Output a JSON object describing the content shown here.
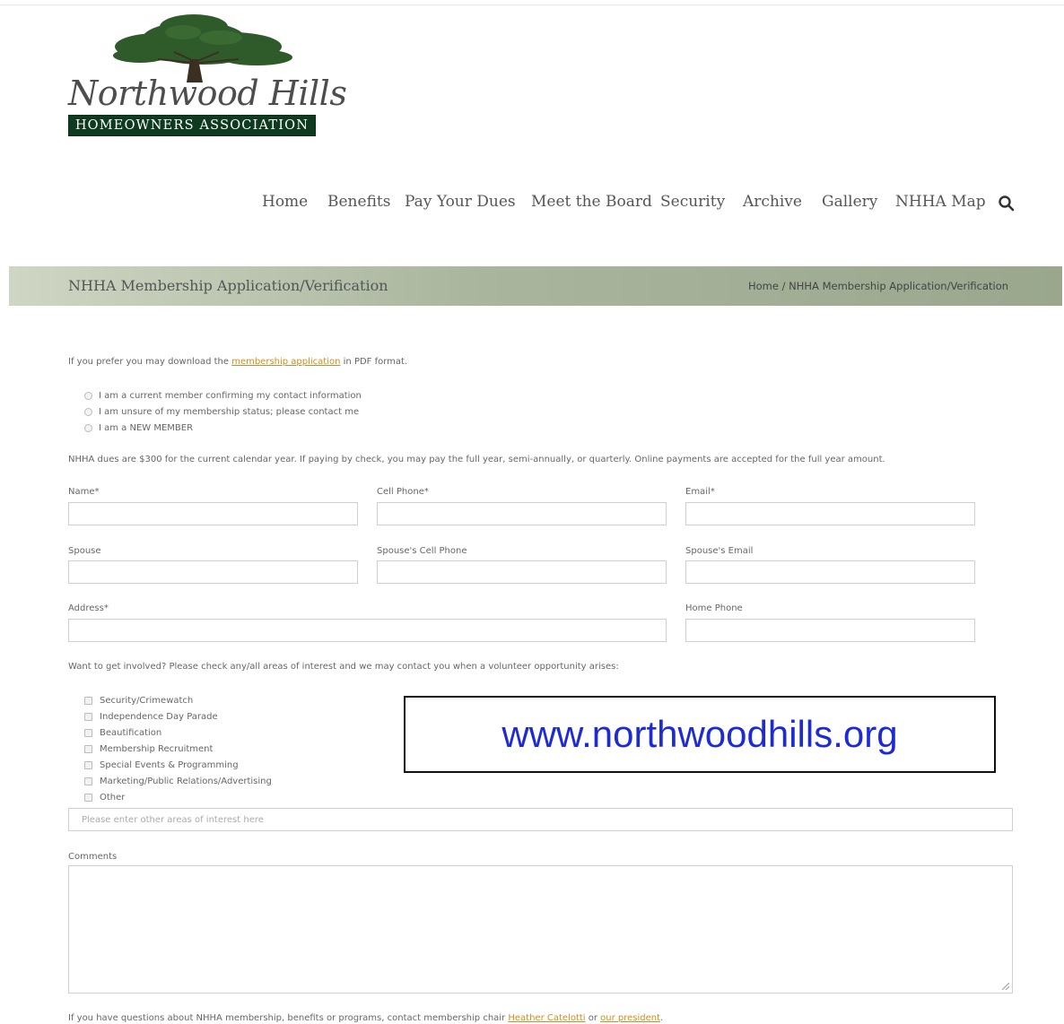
{
  "logo": {
    "script_text": "Northwood Hills",
    "band_text": "HOMEOWNERS ASSOCIATION"
  },
  "nav": {
    "items": [
      {
        "label": "Home"
      },
      {
        "label": "Benefits"
      },
      {
        "label": "Pay Your Dues"
      },
      {
        "label": "Meet the Board"
      },
      {
        "label": "Security"
      },
      {
        "label": "Archive"
      },
      {
        "label": "Gallery"
      },
      {
        "label": "NHHA Map"
      }
    ],
    "search_icon": "search-icon"
  },
  "title_bar": {
    "title": "NHHA Membership Application/Verification",
    "breadcrumb_home": "Home",
    "breadcrumb_sep": " / ",
    "breadcrumb_current": "NHHA Membership Application/Verification"
  },
  "intro": {
    "before": "If you prefer you may download the ",
    "link": "membership application",
    "after": " in PDF format."
  },
  "status_options": [
    {
      "label": "I am a current member confirming my contact information"
    },
    {
      "label": "I am unsure of my membership status; please contact me"
    },
    {
      "label": "I am a NEW MEMBER"
    }
  ],
  "dues_text": "NHHA dues are $300 for the current calendar year. If paying by check, you may pay the full year, semi-annually, or quarterly. Online payments are accepted for the full year amount.",
  "fields": {
    "name": "Name*",
    "cell_phone": "Cell Phone*",
    "email": "Email*",
    "spouse": "Spouse",
    "spouse_cell": "Spouse's Cell Phone",
    "spouse_email": "Spouse's Email",
    "address": "Address*",
    "home_phone": "Home Phone"
  },
  "involvement": {
    "prompt": "Want to get involved? Please check any/all areas of interest and we may contact you when a volunteer opportunity arises:",
    "options": [
      {
        "label": "Security/Crimewatch"
      },
      {
        "label": "Independence Day Parade"
      },
      {
        "label": "Beautification"
      },
      {
        "label": "Membership Recruitment"
      },
      {
        "label": "Special Events & Programming"
      },
      {
        "label": "Marketing/Public Relations/Advertising"
      },
      {
        "label": "Other"
      }
    ],
    "other_placeholder": "Please enter other areas of interest here"
  },
  "comments_label": "Comments",
  "footer": {
    "before": "If you have questions about NHHA membership, benefits or programs, contact membership chair ",
    "link1": "Heather Catelotti",
    "middle": " or ",
    "link2": "our president",
    "after": "."
  },
  "watermark": "www.northwoodhills.org",
  "colors": {
    "link": "#d08b1e",
    "logo_band": "#0e3b1f",
    "tree": "#2f5a2a",
    "watermark": "#1d2bd6"
  }
}
